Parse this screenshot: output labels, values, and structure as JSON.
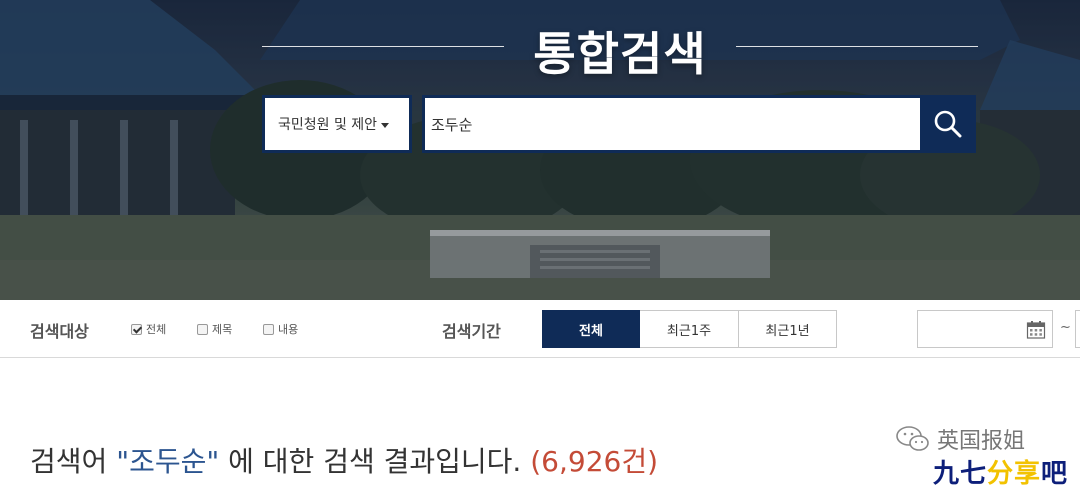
{
  "hero": {
    "title": "통합검색",
    "search": {
      "category": "국민청원 및 제안",
      "query": "조두순"
    }
  },
  "filter": {
    "target_label": "검색대상",
    "targets": [
      {
        "label": "전체",
        "checked": true
      },
      {
        "label": "제목",
        "checked": false
      },
      {
        "label": "내용",
        "checked": false
      }
    ],
    "period_label": "검색기간",
    "periods": [
      {
        "label": "전체",
        "active": true
      },
      {
        "label": "최근1주",
        "active": false
      },
      {
        "label": "최근1년",
        "active": false
      }
    ],
    "date_separator": "~"
  },
  "result": {
    "prefix": "검색어 ",
    "keyword": "\"조두순\"",
    "suffix": " 에 대한 검색 결과입니다. ",
    "count": "(6,926건)"
  },
  "watermark": {
    "line1": "英国报姐",
    "line2a": "九七",
    "line2b": "分享",
    "line2c": "吧"
  },
  "colors": {
    "navy": "#0f2b57",
    "keyword": "#2c5590",
    "count": "#c44b37"
  },
  "icons": [
    "search-icon",
    "calendar-icon",
    "checkbox-icon",
    "wechat-icon",
    "caret-down-icon"
  ]
}
